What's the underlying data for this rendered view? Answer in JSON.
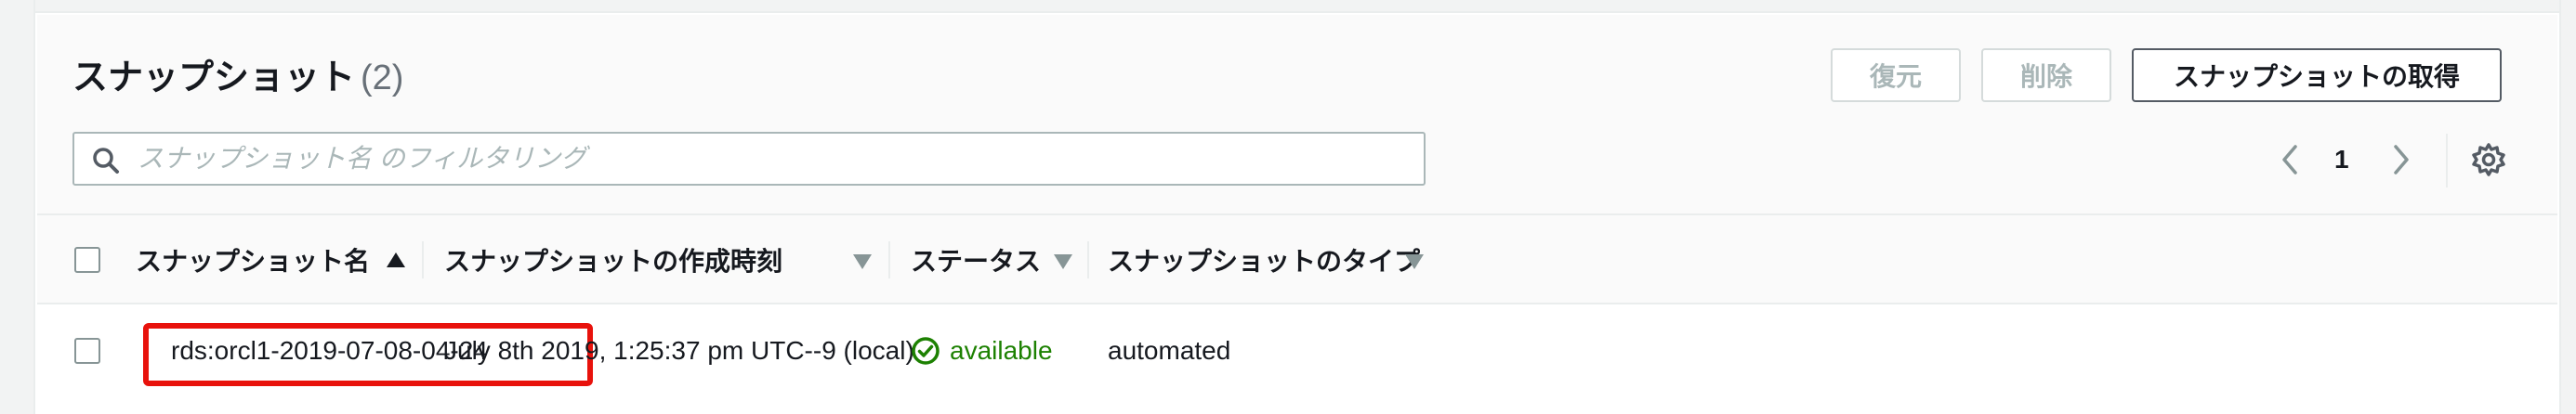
{
  "header": {
    "title": "スナップショット",
    "count": "(2)"
  },
  "actions": {
    "restore_label": "復元",
    "delete_label": "削除",
    "take_snapshot_label": "スナップショットの取得"
  },
  "search": {
    "placeholder": "スナップショット名 のフィルタリング",
    "value": ""
  },
  "pagination": {
    "current_page": "1"
  },
  "table": {
    "columns": [
      "スナップショット名",
      "スナップショットの作成時刻",
      "ステータス",
      "スナップショットのタイプ"
    ],
    "rows": [
      {
        "name": "rds:orcl1-2019-07-08-04-24",
        "created": "July 8th 2019, 1:25:37 pm UTC--9 (local)",
        "status": "available",
        "type": "automated"
      }
    ]
  },
  "colors": {
    "status_ok": "#1d8102",
    "highlight": "#e8120c"
  }
}
